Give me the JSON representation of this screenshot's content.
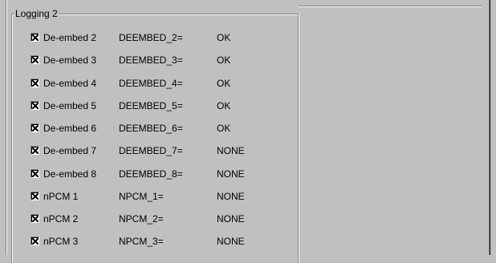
{
  "group": {
    "title": "Logging 2"
  },
  "rows": [
    {
      "label": "De-embed 2",
      "checked": true,
      "key": "DEEMBED_2=",
      "status": "OK"
    },
    {
      "label": "De-embed 3",
      "checked": true,
      "key": "DEEMBED_3=",
      "status": "OK"
    },
    {
      "label": "De-embed 4",
      "checked": true,
      "key": "DEEMBED_4=",
      "status": "OK"
    },
    {
      "label": "De-embed 5",
      "checked": true,
      "key": "DEEMBED_5=",
      "status": "OK"
    },
    {
      "label": "De-embed 6",
      "checked": true,
      "key": "DEEMBED_6=",
      "status": "OK"
    },
    {
      "label": "De-embed 7",
      "checked": true,
      "key": "DEEMBED_7=",
      "status": "NONE"
    },
    {
      "label": "De-embed 8",
      "checked": true,
      "key": "DEEMBED_8=",
      "status": "NONE"
    },
    {
      "label": "nPCM 1",
      "checked": true,
      "key": "NPCM_1=",
      "status": "NONE"
    },
    {
      "label": "nPCM 2",
      "checked": true,
      "key": "NPCM_2=",
      "status": "NONE"
    },
    {
      "label": "nPCM 3",
      "checked": true,
      "key": "NPCM_3=",
      "status": "NONE"
    }
  ]
}
